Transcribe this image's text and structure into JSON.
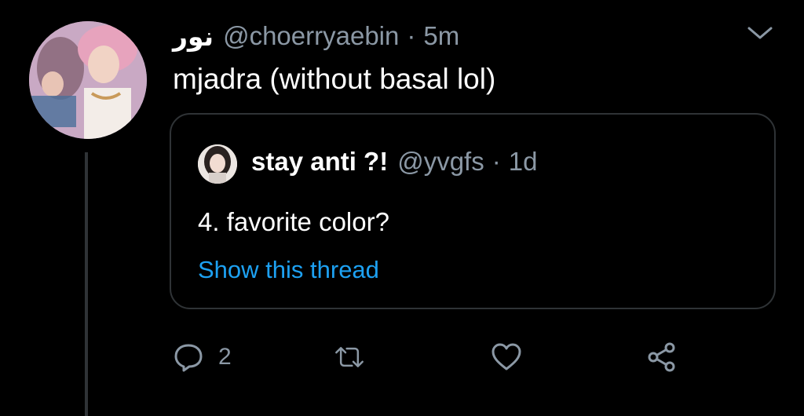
{
  "tweet": {
    "author_name": "نور",
    "author_handle": "@choerryaebin",
    "separator": "·",
    "time": "5m",
    "text": "mjadra (without basal lol)",
    "menu_icon": "chevron-down-icon",
    "reply_count": "2"
  },
  "quote": {
    "author_name": "stay anti ?!",
    "author_handle": "@yvgfs",
    "separator": "·",
    "time": "1d",
    "text": "4. favorite color?",
    "show_thread": "Show this thread"
  },
  "actions": {
    "reply_icon": "reply-icon",
    "retweet_icon": "retweet-icon",
    "like_icon": "heart-icon",
    "share_icon": "share-icon"
  },
  "colors": {
    "background": "#000000",
    "text": "#ffffff",
    "muted": "#8b98a5",
    "border": "#2f3336",
    "link": "#1da1f2"
  }
}
